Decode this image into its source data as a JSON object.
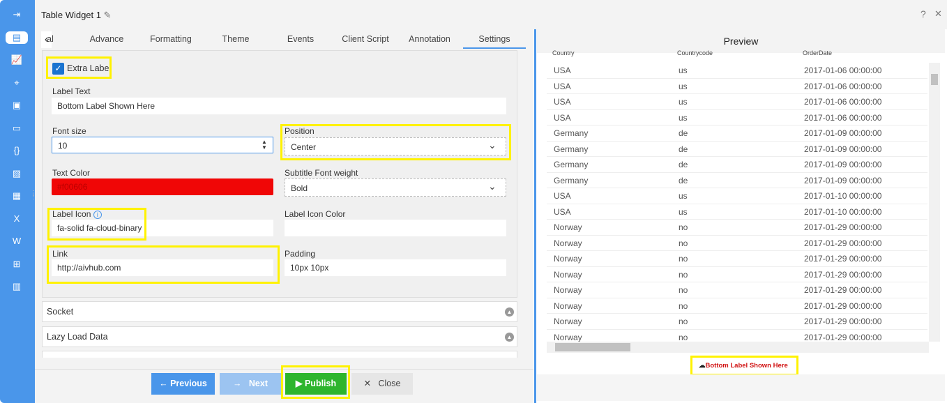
{
  "window": {
    "title": "Table Widget 1",
    "help": "?",
    "close": "✕"
  },
  "sidebar": {
    "icons": [
      "sign-in-icon",
      "table-icon",
      "chart-icon",
      "map-icon",
      "report-icon",
      "card-icon",
      "code-icon",
      "image-icon",
      "layout-icon",
      "excel-icon",
      "word-icon",
      "tree-icon",
      "analytics-icon"
    ]
  },
  "tabs": [
    {
      "label": "al"
    },
    {
      "label": "Advance"
    },
    {
      "label": "Formatting"
    },
    {
      "label": "Theme"
    },
    {
      "label": "Events"
    },
    {
      "label": "Client Script"
    },
    {
      "label": "Annotation"
    },
    {
      "label": "Settings",
      "selected": true
    }
  ],
  "form": {
    "extra_label": {
      "label": "Extra Label",
      "checked": true
    },
    "label_text": {
      "label": "Label Text",
      "value": "Bottom Label Shown Here"
    },
    "font_size": {
      "label": "Font size",
      "value": "10"
    },
    "position": {
      "label": "Position",
      "value": "Center"
    },
    "text_color": {
      "label": "Text Color",
      "value": "#f00606"
    },
    "subtitle_font_weight": {
      "label": "Subtitle Font weight",
      "value": "Bold"
    },
    "label_icon": {
      "label": "Label Icon",
      "value": "fa-solid fa-cloud-binary"
    },
    "label_icon_color": {
      "label": "Label Icon Color",
      "value": ""
    },
    "link": {
      "label": "Link",
      "value": "http://aivhub.com"
    },
    "padding": {
      "label": "Padding",
      "value": "10px 10px"
    }
  },
  "accordions": [
    {
      "label": "Socket"
    },
    {
      "label": "Lazy Load Data"
    }
  ],
  "footer": {
    "previous": "Previous",
    "next": "Next",
    "publish": "Publish",
    "close": "Close"
  },
  "preview": {
    "title": "Preview",
    "columns": [
      "Country",
      "Countrycode",
      "OrderDate"
    ],
    "rows": [
      [
        "USA",
        "us",
        "2017-01-06 00:00:00"
      ],
      [
        "USA",
        "us",
        "2017-01-06 00:00:00"
      ],
      [
        "USA",
        "us",
        "2017-01-06 00:00:00"
      ],
      [
        "USA",
        "us",
        "2017-01-06 00:00:00"
      ],
      [
        "Germany",
        "de",
        "2017-01-09 00:00:00"
      ],
      [
        "Germany",
        "de",
        "2017-01-09 00:00:00"
      ],
      [
        "Germany",
        "de",
        "2017-01-09 00:00:00"
      ],
      [
        "Germany",
        "de",
        "2017-01-09 00:00:00"
      ],
      [
        "USA",
        "us",
        "2017-01-10 00:00:00"
      ],
      [
        "USA",
        "us",
        "2017-01-10 00:00:00"
      ],
      [
        "Norway",
        "no",
        "2017-01-29 00:00:00"
      ],
      [
        "Norway",
        "no",
        "2017-01-29 00:00:00"
      ],
      [
        "Norway",
        "no",
        "2017-01-29 00:00:00"
      ],
      [
        "Norway",
        "no",
        "2017-01-29 00:00:00"
      ],
      [
        "Norway",
        "no",
        "2017-01-29 00:00:00"
      ],
      [
        "Norway",
        "no",
        "2017-01-29 00:00:00"
      ],
      [
        "Norway",
        "no",
        "2017-01-29 00:00:00"
      ],
      [
        "Norway",
        "no",
        "2017-01-29 00:00:00"
      ]
    ],
    "bottom_label": "Bottom Label Shown Here"
  },
  "colors": {
    "accent": "#4a96ea",
    "publish": "#2db52d",
    "highlight": "#fff200",
    "label_red": "#f00606"
  }
}
